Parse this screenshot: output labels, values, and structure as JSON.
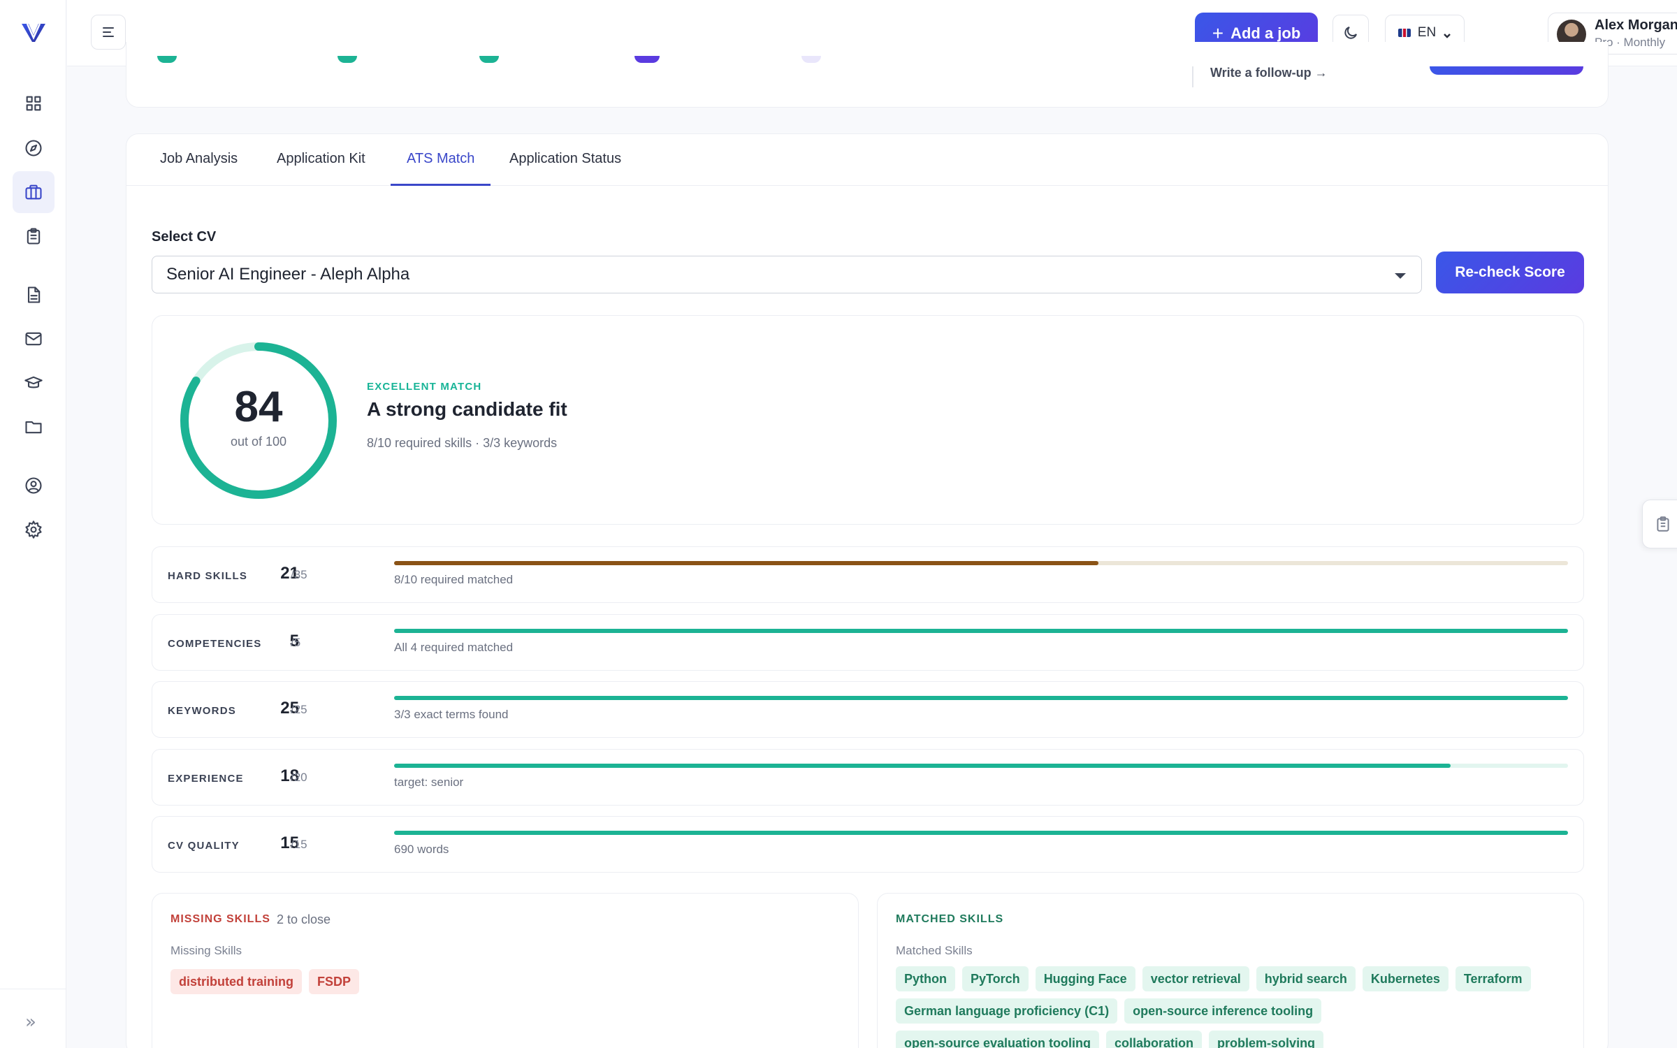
{
  "topbar": {
    "add_job_label": "Add a job",
    "lang_label": "EN",
    "user_name": "Alex Morgan",
    "user_plan": "Pro · Monthly"
  },
  "upper": {
    "followup_label": "Write a follow-up →"
  },
  "tabs": [
    {
      "label": "Job Analysis"
    },
    {
      "label": "Application Kit"
    },
    {
      "label": "ATS Match"
    },
    {
      "label": "Application Status"
    }
  ],
  "cv": {
    "label": "Select CV",
    "selected": "Senior AI Engineer - Aleph Alpha",
    "recheck_label": "Re-check Score"
  },
  "score": {
    "value": "84",
    "out_of": "out of 100",
    "fraction": 0.84,
    "tag": "EXCELLENT MATCH",
    "title": "A strong candidate fit",
    "summary": "8/10 required skills · 3/3 keywords"
  },
  "metrics": [
    {
      "label": "HARD SKILLS",
      "score": "21",
      "max": "/35",
      "note": "8/10 required matched",
      "fraction": 0.6,
      "color": "#8a5316",
      "track": "#ece6d8"
    },
    {
      "label": "COMPETENCIES",
      "score": "5",
      "max": "/5",
      "note": "All 4 required matched",
      "fraction": 1.0,
      "color": "#1cb394",
      "track": "#e2f5ef"
    },
    {
      "label": "KEYWORDS",
      "score": "25",
      "max": "/25",
      "note": "3/3 exact terms found",
      "fraction": 1.0,
      "color": "#1cb394",
      "track": "#e2f5ef"
    },
    {
      "label": "EXPERIENCE",
      "score": "18",
      "max": "/20",
      "note": "target: senior",
      "fraction": 0.9,
      "color": "#1cb394",
      "track": "#e2f5ef"
    },
    {
      "label": "CV QUALITY",
      "score": "15",
      "max": "/15",
      "note": "690 words",
      "fraction": 1.0,
      "color": "#1cb394",
      "track": "#e2f5ef"
    }
  ],
  "missing": {
    "heading": "MISSING SKILLS",
    "count": "2 to close",
    "sub": "Missing Skills",
    "chips": [
      "distributed training",
      "FSDP"
    ]
  },
  "matched": {
    "heading": "MATCHED SKILLS",
    "sub": "Matched Skills",
    "row1": [
      "Python",
      "PyTorch",
      "Hugging Face",
      "vector retrieval",
      "hybrid search",
      "Kubernetes",
      "Terraform"
    ],
    "row2": [
      "German language proficiency (C1)",
      "open-source inference tooling"
    ],
    "row3": [
      "open-source evaluation tooling",
      "collaboration",
      "problem-solving"
    ]
  },
  "colors": {
    "accent": "#3a47c9",
    "teal": "#1cb394",
    "missing_red": "#c2413a",
    "matched_green": "#1f7a5c"
  }
}
